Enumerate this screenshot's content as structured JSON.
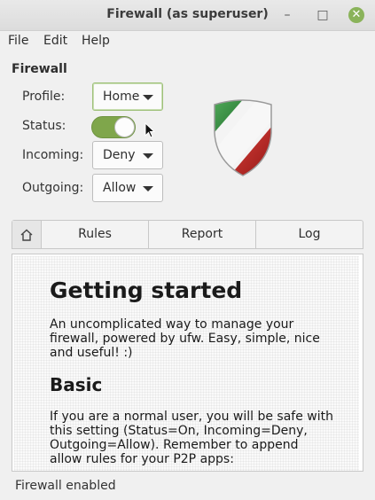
{
  "window": {
    "title": "Firewall (as superuser)",
    "min_glyph": "–",
    "max_glyph": "□",
    "close_glyph": "✕"
  },
  "menu": [
    "File",
    "Edit",
    "Help"
  ],
  "firewall": {
    "section_title": "Firewall",
    "profile": {
      "label": "Profile:",
      "value": "Home"
    },
    "status": {
      "label": "Status:",
      "on": true
    },
    "incoming": {
      "label": "Incoming:",
      "value": "Deny"
    },
    "outgoing": {
      "label": "Outgoing:",
      "value": "Allow"
    }
  },
  "tabs": {
    "home_icon": "home-icon",
    "rules": "Rules",
    "report": "Report",
    "log": "Log"
  },
  "doc": {
    "h1": "Getting started",
    "intro": "An uncomplicated way to manage your firewall, powered by ufw. Easy, simple, nice and useful! :)",
    "h2": "Basic",
    "basic": "If you are a normal user, you will be safe with this setting (Status=On, Incoming=Deny, Outgoing=Allow). Remember to append allow rules for your P2P apps:"
  },
  "status_bar": "Firewall enabled",
  "colors": {
    "accent": "#7fa64b",
    "close_button": "#8ab35a",
    "shield_red": "#c0201e",
    "shield_green": "#2f8a3a"
  }
}
